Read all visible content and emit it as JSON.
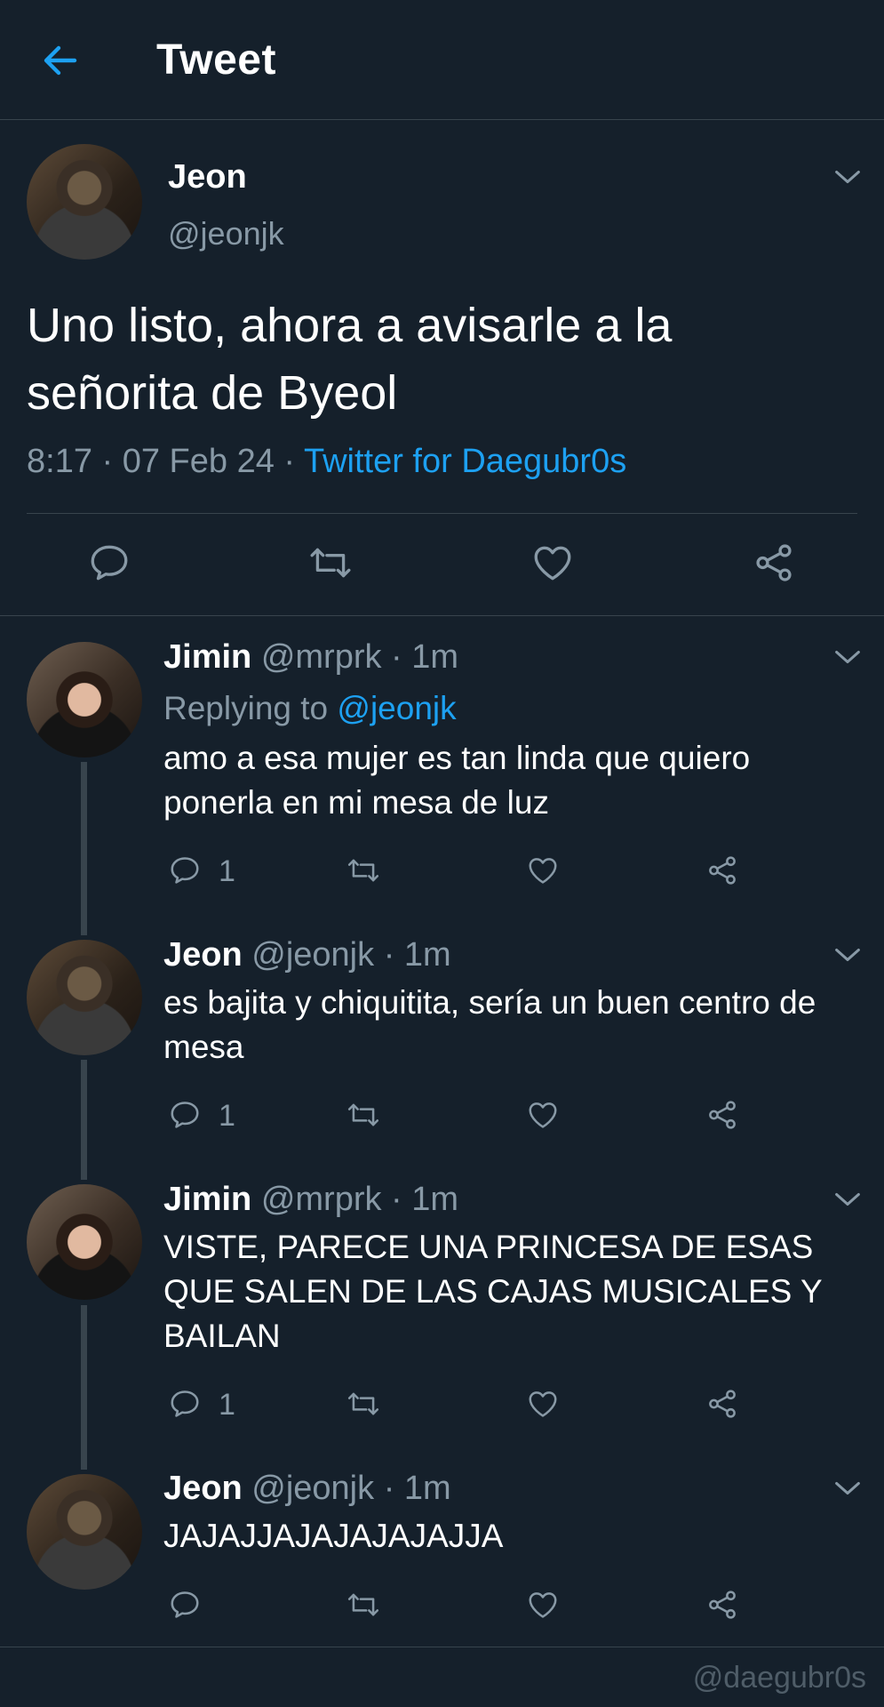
{
  "header": {
    "title": "Tweet"
  },
  "tweet": {
    "name": "Jeon",
    "handle": "@jeonjk",
    "text": "Uno listo, ahora a avisarle a la señorita de Byeol",
    "time": "8:17 · 07 Feb 24 · ",
    "source": "Twitter for Daegubr0s"
  },
  "replies": [
    {
      "name": "Jimin",
      "handle": "@mrprk",
      "age": "· 1m",
      "replying_label": "Replying to ",
      "replying_to": "@jeonjk",
      "text": "amo a esa mujer es tan linda que quiero ponerla en mi mesa de luz",
      "reply_count": "1"
    },
    {
      "name": "Jeon",
      "handle": "@jeonjk",
      "age": "· 1m",
      "text": "es bajita y chiquitita, sería un buen centro de mesa",
      "reply_count": "1"
    },
    {
      "name": "Jimin",
      "handle": "@mrprk",
      "age": "· 1m",
      "text": "VISTE, PARECE UNA PRINCESA DE ESAS QUE SALEN DE LAS CAJAS MUSICALES Y BAILAN",
      "reply_count": "1"
    },
    {
      "name": "Jeon",
      "handle": "@jeonjk",
      "age": "· 1m",
      "text": "JAJAJJAJAJAJAJAJJA",
      "reply_count": ""
    }
  ],
  "watermark": "@daegubr0s",
  "colors": {
    "background": "#15202b",
    "accent": "#1da1f2",
    "muted": "#8899a6",
    "border": "#38444d"
  },
  "icons": [
    "back-arrow-icon",
    "chevron-down-icon",
    "reply-icon",
    "retweet-icon",
    "like-icon",
    "share-icon"
  ]
}
